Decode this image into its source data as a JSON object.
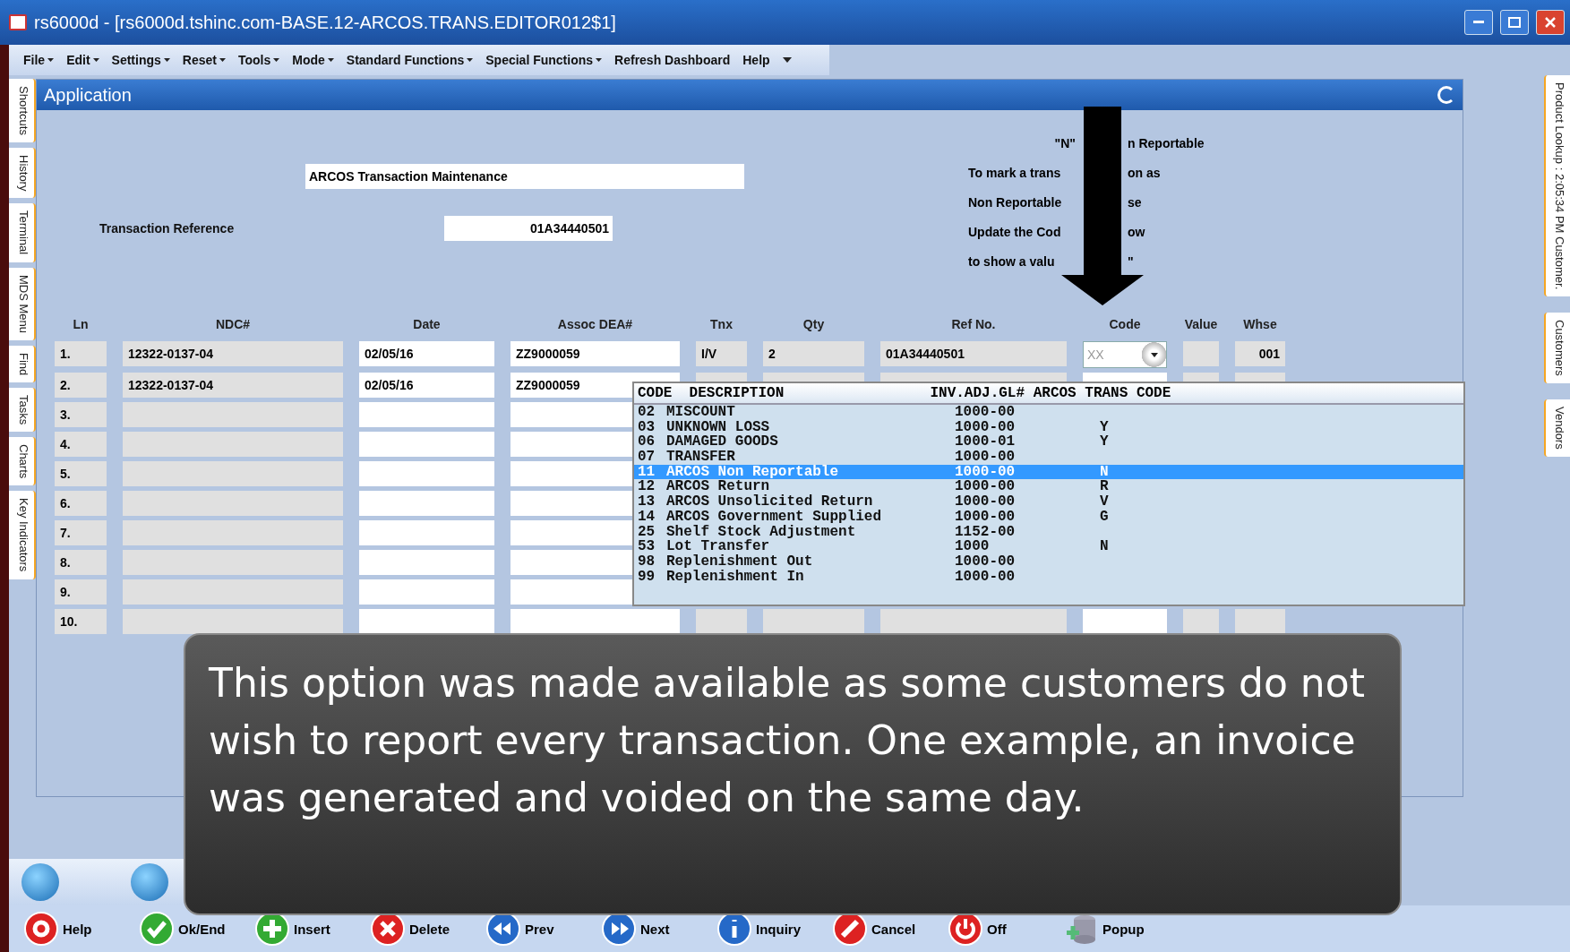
{
  "window": {
    "title": "rs6000d - [rs6000d.tshinc.com-BASE.12-ARCOS.TRANS.EDITOR012$1]"
  },
  "menu": [
    {
      "label": "File",
      "dropdown": true
    },
    {
      "label": "Edit",
      "dropdown": true
    },
    {
      "label": "Settings",
      "dropdown": true
    },
    {
      "label": "Reset",
      "dropdown": true
    },
    {
      "label": "Tools",
      "dropdown": true
    },
    {
      "label": "Mode",
      "dropdown": true
    },
    {
      "label": "Standard Functions",
      "dropdown": true
    },
    {
      "label": "Special Functions",
      "dropdown": true
    },
    {
      "label": "Refresh Dashboard",
      "dropdown": false
    },
    {
      "label": "Help",
      "dropdown": false
    }
  ],
  "left_tabs": [
    "Shortcuts",
    "History",
    "Terminal",
    "MDS Menu",
    "Find",
    "Tasks",
    "Charts",
    "Key Indicators"
  ],
  "right_tabs": [
    "Product Lookup : 2:05:34 PM Customer.",
    "Customers",
    "Vendors"
  ],
  "panel": {
    "title": "Application"
  },
  "form": {
    "title": "ARCOS Transaction Maintenance",
    "reference_label": "Transaction Reference",
    "reference_value": "01A34440501"
  },
  "note_lines": [
    [
      "\"N\"",
      "n Reportable"
    ],
    [
      "To mark a trans",
      "on as"
    ],
    [
      "Non Reportable",
      "se"
    ],
    [
      "Update the Cod",
      "ow"
    ],
    [
      "to show a valu",
      "\""
    ]
  ],
  "table": {
    "columns": [
      "Ln",
      "NDC#",
      "Date",
      "Assoc DEA#",
      "Tnx",
      "Qty",
      "Ref No.",
      "Code",
      "Value",
      "Whse"
    ],
    "rows": [
      {
        "ln": "1.",
        "ndc": "12322-0137-04",
        "date": "02/05/16",
        "dea": "ZZ9000059",
        "tnx": "I/V",
        "qty": "2",
        "ref": "01A34440501",
        "code_placeholder": "XX",
        "whse": "001"
      },
      {
        "ln": "2.",
        "ndc": "12322-0137-04",
        "date": "02/05/16",
        "dea": "ZZ9000059"
      },
      {
        "ln": "3."
      },
      {
        "ln": "4."
      },
      {
        "ln": "5."
      },
      {
        "ln": "6."
      },
      {
        "ln": "7."
      },
      {
        "ln": "8."
      },
      {
        "ln": "9."
      },
      {
        "ln": "10."
      }
    ]
  },
  "popup": {
    "header": "CODE  DESCRIPTION                 INV.ADJ.GL# ARCOS TRANS CODE",
    "items": [
      {
        "code": "02",
        "description": "MISCOUNT",
        "gl": "1000-00",
        "selected": false
      },
      {
        "code": "03",
        "description": "UNKNOWN LOSS",
        "gl": "1000-00",
        "arcos": "Y",
        "selected": false
      },
      {
        "code": "06",
        "description": "DAMAGED GOODS",
        "gl": "1000-01",
        "arcos": "Y",
        "selected": false
      },
      {
        "code": "07",
        "description": "TRANSFER",
        "gl": "1000-00",
        "selected": false
      },
      {
        "code": "11",
        "description": "ARCOS Non Reportable",
        "gl": "1000-00",
        "arcos": "N",
        "selected": true
      },
      {
        "code": "12",
        "description": "ARCOS Return",
        "gl": "1000-00",
        "arcos": "R",
        "selected": false
      },
      {
        "code": "13",
        "description": "ARCOS Unsolicited Return",
        "gl": "1000-00",
        "arcos": "V",
        "selected": false
      },
      {
        "code": "14",
        "description": "ARCOS Government Supplied",
        "gl": "1000-00",
        "arcos": "G",
        "selected": false
      },
      {
        "code": "25",
        "description": "Shelf Stock Adjustment",
        "gl": "1152-00",
        "selected": false
      },
      {
        "code": "53",
        "description": "Lot Transfer",
        "gl": "1000",
        "arcos": "N",
        "selected": false
      },
      {
        "code": "98",
        "description": "Replenishment Out",
        "gl": "1000-00",
        "selected": false
      },
      {
        "code": "99",
        "description": "Replenishment In",
        "gl": "1000-00",
        "selected": false
      }
    ]
  },
  "caption": "This option was made available as some customers do not wish to report every transaction. One example, an invoice was generated and voided on the same day.",
  "toolbar": [
    {
      "label": "Help",
      "kind": "help"
    },
    {
      "label": "Ok/End",
      "kind": "ok"
    },
    {
      "label": "Insert",
      "kind": "insert"
    },
    {
      "label": "Delete",
      "kind": "delete"
    },
    {
      "label": "Prev",
      "kind": "prev"
    },
    {
      "label": "Next",
      "kind": "next"
    },
    {
      "label": "Inquiry",
      "kind": "info"
    },
    {
      "label": "Cancel",
      "kind": "cancel"
    },
    {
      "label": "Off",
      "kind": "off"
    },
    {
      "label": "Popup",
      "kind": "popup"
    }
  ]
}
